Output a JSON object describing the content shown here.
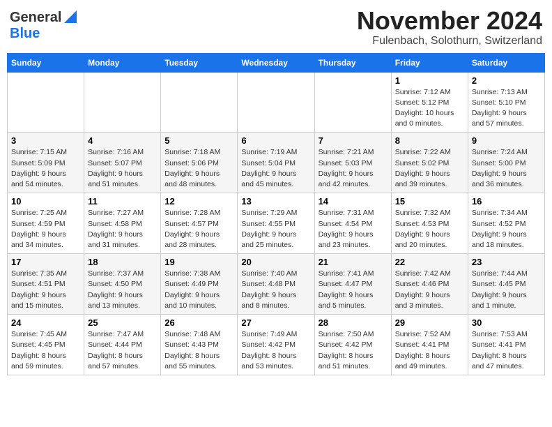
{
  "header": {
    "logo_general": "General",
    "logo_blue": "Blue",
    "month_title": "November 2024",
    "location": "Fulenbach, Solothurn, Switzerland"
  },
  "weekdays": [
    "Sunday",
    "Monday",
    "Tuesday",
    "Wednesday",
    "Thursday",
    "Friday",
    "Saturday"
  ],
  "weeks": [
    [
      {
        "day": "",
        "info": ""
      },
      {
        "day": "",
        "info": ""
      },
      {
        "day": "",
        "info": ""
      },
      {
        "day": "",
        "info": ""
      },
      {
        "day": "",
        "info": ""
      },
      {
        "day": "1",
        "info": "Sunrise: 7:12 AM\nSunset: 5:12 PM\nDaylight: 10 hours\nand 0 minutes."
      },
      {
        "day": "2",
        "info": "Sunrise: 7:13 AM\nSunset: 5:10 PM\nDaylight: 9 hours\nand 57 minutes."
      }
    ],
    [
      {
        "day": "3",
        "info": "Sunrise: 7:15 AM\nSunset: 5:09 PM\nDaylight: 9 hours\nand 54 minutes."
      },
      {
        "day": "4",
        "info": "Sunrise: 7:16 AM\nSunset: 5:07 PM\nDaylight: 9 hours\nand 51 minutes."
      },
      {
        "day": "5",
        "info": "Sunrise: 7:18 AM\nSunset: 5:06 PM\nDaylight: 9 hours\nand 48 minutes."
      },
      {
        "day": "6",
        "info": "Sunrise: 7:19 AM\nSunset: 5:04 PM\nDaylight: 9 hours\nand 45 minutes."
      },
      {
        "day": "7",
        "info": "Sunrise: 7:21 AM\nSunset: 5:03 PM\nDaylight: 9 hours\nand 42 minutes."
      },
      {
        "day": "8",
        "info": "Sunrise: 7:22 AM\nSunset: 5:02 PM\nDaylight: 9 hours\nand 39 minutes."
      },
      {
        "day": "9",
        "info": "Sunrise: 7:24 AM\nSunset: 5:00 PM\nDaylight: 9 hours\nand 36 minutes."
      }
    ],
    [
      {
        "day": "10",
        "info": "Sunrise: 7:25 AM\nSunset: 4:59 PM\nDaylight: 9 hours\nand 34 minutes."
      },
      {
        "day": "11",
        "info": "Sunrise: 7:27 AM\nSunset: 4:58 PM\nDaylight: 9 hours\nand 31 minutes."
      },
      {
        "day": "12",
        "info": "Sunrise: 7:28 AM\nSunset: 4:57 PM\nDaylight: 9 hours\nand 28 minutes."
      },
      {
        "day": "13",
        "info": "Sunrise: 7:29 AM\nSunset: 4:55 PM\nDaylight: 9 hours\nand 25 minutes."
      },
      {
        "day": "14",
        "info": "Sunrise: 7:31 AM\nSunset: 4:54 PM\nDaylight: 9 hours\nand 23 minutes."
      },
      {
        "day": "15",
        "info": "Sunrise: 7:32 AM\nSunset: 4:53 PM\nDaylight: 9 hours\nand 20 minutes."
      },
      {
        "day": "16",
        "info": "Sunrise: 7:34 AM\nSunset: 4:52 PM\nDaylight: 9 hours\nand 18 minutes."
      }
    ],
    [
      {
        "day": "17",
        "info": "Sunrise: 7:35 AM\nSunset: 4:51 PM\nDaylight: 9 hours\nand 15 minutes."
      },
      {
        "day": "18",
        "info": "Sunrise: 7:37 AM\nSunset: 4:50 PM\nDaylight: 9 hours\nand 13 minutes."
      },
      {
        "day": "19",
        "info": "Sunrise: 7:38 AM\nSunset: 4:49 PM\nDaylight: 9 hours\nand 10 minutes."
      },
      {
        "day": "20",
        "info": "Sunrise: 7:40 AM\nSunset: 4:48 PM\nDaylight: 9 hours\nand 8 minutes."
      },
      {
        "day": "21",
        "info": "Sunrise: 7:41 AM\nSunset: 4:47 PM\nDaylight: 9 hours\nand 5 minutes."
      },
      {
        "day": "22",
        "info": "Sunrise: 7:42 AM\nSunset: 4:46 PM\nDaylight: 9 hours\nand 3 minutes."
      },
      {
        "day": "23",
        "info": "Sunrise: 7:44 AM\nSunset: 4:45 PM\nDaylight: 9 hours\nand 1 minute."
      }
    ],
    [
      {
        "day": "24",
        "info": "Sunrise: 7:45 AM\nSunset: 4:45 PM\nDaylight: 8 hours\nand 59 minutes."
      },
      {
        "day": "25",
        "info": "Sunrise: 7:47 AM\nSunset: 4:44 PM\nDaylight: 8 hours\nand 57 minutes."
      },
      {
        "day": "26",
        "info": "Sunrise: 7:48 AM\nSunset: 4:43 PM\nDaylight: 8 hours\nand 55 minutes."
      },
      {
        "day": "27",
        "info": "Sunrise: 7:49 AM\nSunset: 4:42 PM\nDaylight: 8 hours\nand 53 minutes."
      },
      {
        "day": "28",
        "info": "Sunrise: 7:50 AM\nSunset: 4:42 PM\nDaylight: 8 hours\nand 51 minutes."
      },
      {
        "day": "29",
        "info": "Sunrise: 7:52 AM\nSunset: 4:41 PM\nDaylight: 8 hours\nand 49 minutes."
      },
      {
        "day": "30",
        "info": "Sunrise: 7:53 AM\nSunset: 4:41 PM\nDaylight: 8 hours\nand 47 minutes."
      }
    ]
  ]
}
